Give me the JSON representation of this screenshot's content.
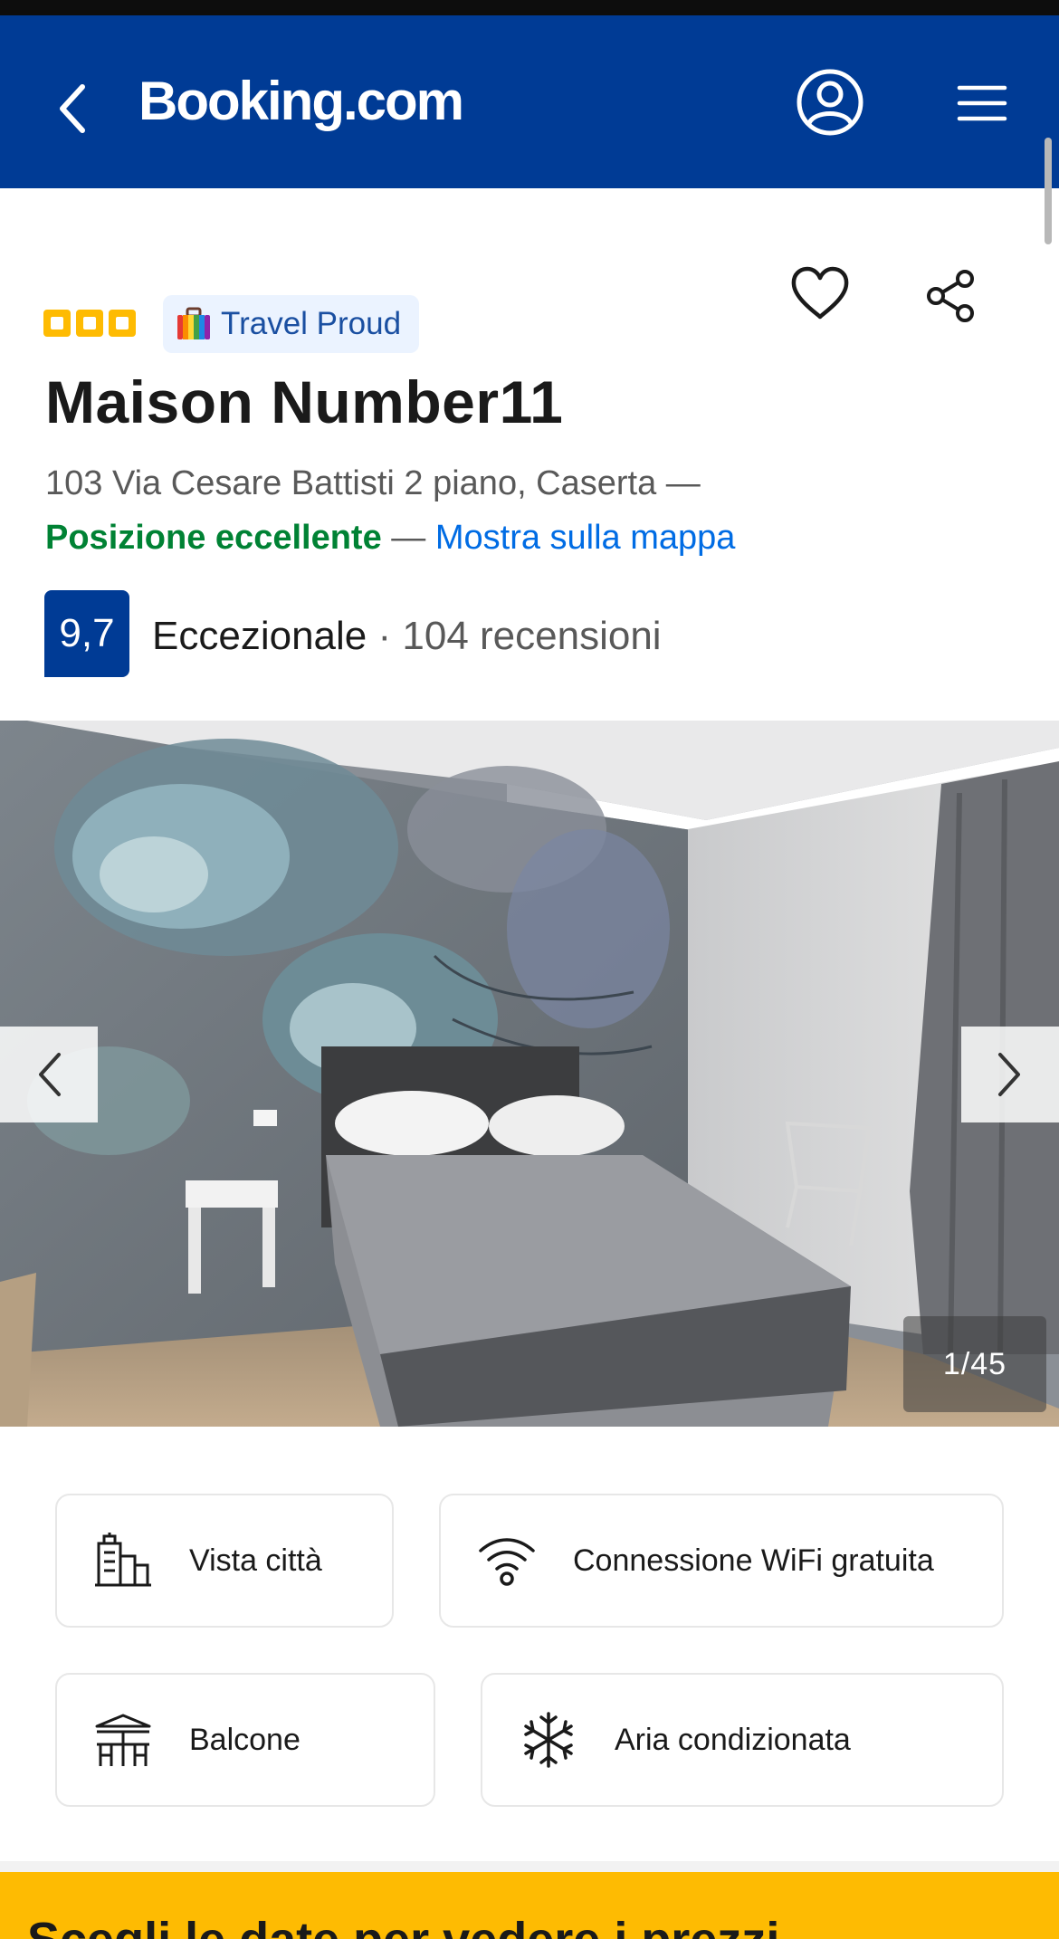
{
  "header": {
    "logo_text": "Booking.com",
    "background_color": "#003b95",
    "back_icon": "chevron-left-icon",
    "account_icon": "account-icon",
    "menu_icon": "hamburger-menu-icon"
  },
  "property": {
    "star_rating": 3,
    "badge_label": "Travel Proud",
    "name": "Maison Number11",
    "address": "103 Via Cesare Battisti 2 piano, Caserta —",
    "location_rating": "Posizione eccellente",
    "location_separator": " — ",
    "map_link": "Mostra sulla mappa",
    "score": "9,7",
    "score_word": "Eccezionale",
    "score_separator": " · ",
    "review_count": "104 recensioni",
    "favorite_icon": "heart-icon",
    "share_icon": "share-icon"
  },
  "gallery": {
    "counter": "1/45",
    "prev_icon": "chevron-left-icon",
    "next_icon": "chevron-right-icon"
  },
  "facilities": [
    {
      "label": "Vista città",
      "icon": "city-view-icon"
    },
    {
      "label": "Connessione WiFi gratuita",
      "icon": "wifi-icon"
    },
    {
      "label": "Balcone",
      "icon": "balcony-icon"
    },
    {
      "label": "Aria condizionata",
      "icon": "snowflake-icon"
    }
  ],
  "cta": {
    "text": "Scegli le date per vedere i prezzi",
    "background_color": "#febb02"
  },
  "colors": {
    "brand_blue": "#003b95",
    "link_blue": "#006ce4",
    "positive_green": "#008234",
    "star_yellow": "#febb02"
  }
}
